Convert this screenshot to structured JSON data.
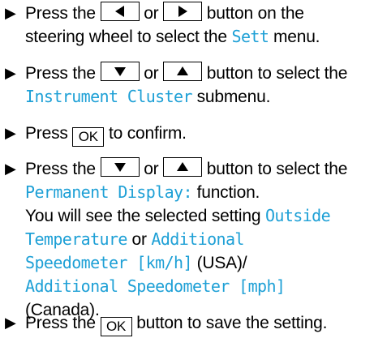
{
  "marker": "▶",
  "steps": [
    {
      "line1_a": "Press the",
      "line1_or": "or",
      "line1_b": "button on the",
      "line2_a": "steering wheel to select the",
      "line2_mono": "Sett",
      "line2_b": "menu."
    },
    {
      "line1_a": "Press the",
      "line1_or": "or",
      "line1_b": "button to select the",
      "line2_mono": "Instrument Cluster",
      "line2_b": "submenu."
    },
    {
      "line1_a": "Press",
      "ok_label": "OK",
      "line1_b": "to confirm."
    },
    {
      "line1_a": "Press the",
      "line1_or": "or",
      "line1_b": "button to select the",
      "line2_mono": "Permanent Display:",
      "line2_b": "function.",
      "line3_a": "You will see the selected setting",
      "line3_mono": "Outside",
      "line4_mono": "Temperature",
      "line4_b": "or",
      "line4_mono2": "Additional",
      "line5_mono": "Speedometer [km/h]",
      "line5_b": "(USA)/",
      "line6_mono": "Additional Speedometer [mph]",
      "line7_a": "(Canada)."
    },
    {
      "line1_a": "Press the",
      "ok_label": "OK",
      "line1_b": "button to save the setting."
    }
  ],
  "icons": {
    "left": "left-arrow-icon",
    "right": "right-arrow-icon",
    "down": "down-arrow-icon",
    "up": "up-arrow-icon"
  }
}
